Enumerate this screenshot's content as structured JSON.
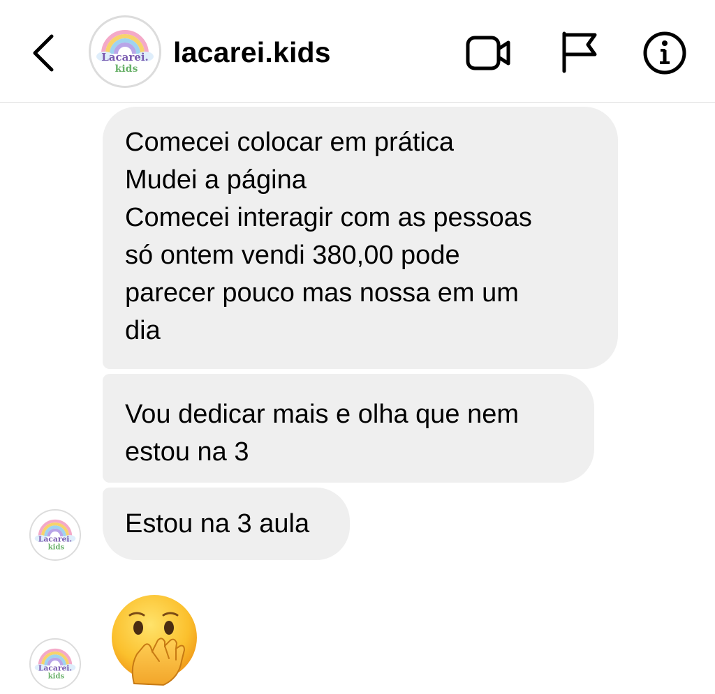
{
  "header": {
    "username": "lacarei.kids",
    "back_icon": "chevron-left-icon",
    "actions": [
      "video-call-icon",
      "flag-icon",
      "info-icon"
    ]
  },
  "logo": {
    "text_line1": "Lacarei.",
    "text_line2": "kids",
    "colors": [
      "#f4a9c8",
      "#f7d36b",
      "#9fd3f0",
      "#b9a5e8"
    ]
  },
  "messages": [
    {
      "lines": [
        "Comecei colocar em prática",
        "Mudei a página",
        "Comecei interagir com as pessoas",
        "só ontem vendi 380,00 pode",
        "parecer pouco mas nossa em um",
        "dia"
      ]
    },
    {
      "lines": [
        "Vou dedicar mais e olha que nem",
        "estou na 3"
      ]
    },
    {
      "lines": [
        "Estou na 3 aula"
      ]
    },
    {
      "emoji": "face-with-hand-over-mouth"
    }
  ],
  "colors": {
    "bubble_bg": "#efefef",
    "divider": "#dbdbdb",
    "text": "#000000"
  }
}
